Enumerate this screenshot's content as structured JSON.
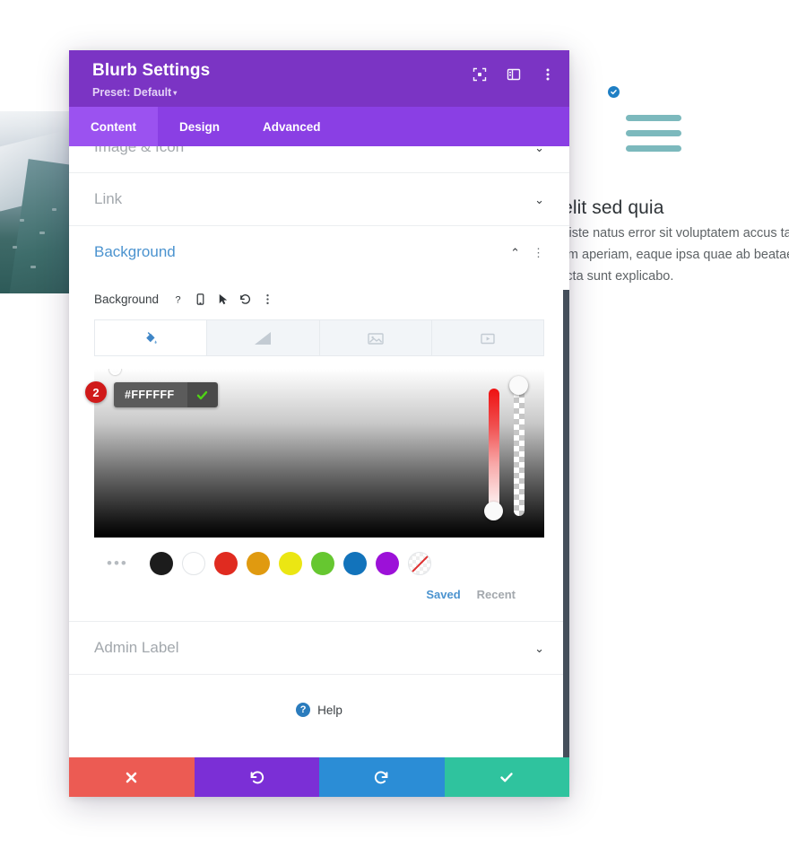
{
  "modal": {
    "title": "Blurb Settings",
    "preset_label": "Preset: Default",
    "preset_caret": "▾",
    "header_icons": [
      {
        "name": "focus-icon",
        "label": "Focus"
      },
      {
        "name": "layout-icon",
        "label": "Layout"
      },
      {
        "name": "more-vertical-icon",
        "label": "More"
      }
    ],
    "tabs": [
      {
        "label": "Content",
        "active": true
      },
      {
        "label": "Design",
        "active": false
      },
      {
        "label": "Advanced",
        "active": false
      }
    ]
  },
  "sections": {
    "image_icon": {
      "title": "Image & Icon",
      "chevron": "⌄",
      "open": false
    },
    "link": {
      "title": "Link",
      "chevron": "⌄",
      "open": false
    },
    "background": {
      "title": "Background",
      "chevron": "⌃",
      "dots": "⋮",
      "open": true
    },
    "admin_label": {
      "title": "Admin Label",
      "chevron": "⌄",
      "open": false
    }
  },
  "background": {
    "field_label": "Background",
    "field_icons": [
      {
        "name": "help-icon",
        "glyph": "?"
      },
      {
        "name": "mobile-icon",
        "glyph": ""
      },
      {
        "name": "hover-cursor-icon",
        "glyph": ""
      },
      {
        "name": "reset-icon",
        "glyph": "↺"
      },
      {
        "name": "more-vertical-icon",
        "glyph": "⋮"
      }
    ],
    "type_tabs": [
      {
        "name": "background-color-tab",
        "label": "Color",
        "active": true
      },
      {
        "name": "background-gradient-tab",
        "label": "Gradient",
        "active": false
      },
      {
        "name": "background-image-tab",
        "label": "Image",
        "active": false
      },
      {
        "name": "background-video-tab",
        "label": "Video",
        "active": false
      }
    ],
    "hex_value": "#FFFFFF",
    "step_badge": "2",
    "swatches": [
      {
        "name": "swatch-black",
        "color": "#1c1c1c"
      },
      {
        "name": "swatch-white",
        "color": "#ffffff"
      },
      {
        "name": "swatch-red",
        "color": "#e02b20"
      },
      {
        "name": "swatch-orange",
        "color": "#e09a10"
      },
      {
        "name": "swatch-yellow",
        "color": "#ebe613"
      },
      {
        "name": "swatch-green",
        "color": "#66c730"
      },
      {
        "name": "swatch-blue",
        "color": "#1273bb"
      },
      {
        "name": "swatch-purple",
        "color": "#9c11d8"
      },
      {
        "name": "swatch-transparent",
        "color": "none"
      }
    ],
    "more_swatches": "•••",
    "saved_label": "Saved",
    "recent_label": "Recent"
  },
  "help": {
    "label": "Help",
    "icon_glyph": "?"
  },
  "footer_buttons": [
    {
      "name": "cancel-button",
      "icon": "close-icon",
      "color": "#ec5b53"
    },
    {
      "name": "undo-button",
      "icon": "undo-icon",
      "color": "#7b2fd6"
    },
    {
      "name": "redo-button",
      "icon": "redo-icon",
      "color": "#2b8dd6"
    },
    {
      "name": "save-button",
      "icon": "check-icon",
      "color": "#2fc39e"
    }
  ],
  "page": {
    "blurb_title": "relit sed quia",
    "blurb_body": "is iste natus error sit voluptatem accus tam rem aperiam, eaque ipsa quae ab beatae vitae dicta sunt explicabo."
  },
  "colors": {
    "header_purple": "#7b34c4",
    "tab_purple": "#8a3fe4",
    "tab_active_purple": "#9b52f0",
    "accent_blue": "#4b93cf",
    "scrollbar": "#454f5b"
  }
}
